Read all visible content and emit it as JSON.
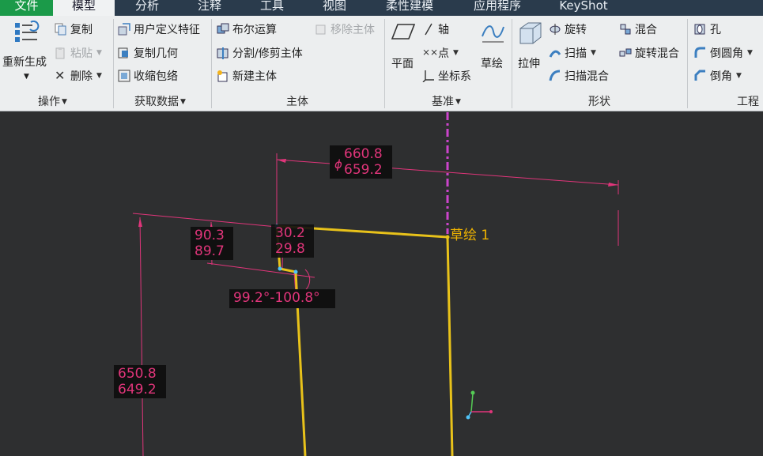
{
  "tabs": [
    {
      "label": "文件"
    },
    {
      "label": "模型"
    },
    {
      "label": "分析"
    },
    {
      "label": "注释"
    },
    {
      "label": "工具"
    },
    {
      "label": "视图"
    },
    {
      "label": "柔性建模"
    },
    {
      "label": "应用程序"
    },
    {
      "label": "KeyShot"
    }
  ],
  "ribbon": {
    "operations": {
      "regenerate": "重新生成",
      "copy": "复制",
      "paste": "粘贴",
      "delete": "删除",
      "group_label": "操作"
    },
    "get_data": {
      "udf": "用户定义特征",
      "copy_geometry": "复制几何",
      "shrinkwrap": "收缩包络",
      "group_label": "获取数据"
    },
    "body": {
      "boolean": "布尔运算",
      "split_trim": "分割/修剪主体",
      "new_body": "新建主体",
      "remove_body": "移除主体",
      "group_label": "主体"
    },
    "datum": {
      "plane": "平面",
      "axis": "轴",
      "point": "点",
      "coord_sys": "坐标系",
      "sketch": "草绘",
      "group_label": "基准"
    },
    "shapes": {
      "extrude": "拉伸",
      "revolve": "旋转",
      "sweep": "扫描",
      "swept_blend": "扫描混合",
      "blend": "混合",
      "rotational_blend": "旋转混合",
      "group_label": "形状"
    },
    "engineering": {
      "hole": "孔",
      "round": "倒圆角",
      "chamfer": "倒角",
      "group_label": "工程"
    }
  },
  "sketch": {
    "label": "草绘 1",
    "dims": {
      "diameter_symbol": "ϕ",
      "diameter_upper": "660.8",
      "diameter_lower": "659.2",
      "left_upper": "90.3",
      "left_lower": "89.7",
      "mid_upper": "30.2",
      "mid_lower": "29.8",
      "angle": "99.2°-100.8°",
      "height_upper": "650.8",
      "height_lower": "649.2"
    }
  },
  "colors": {
    "tab_bar": "#2a3b4c",
    "file_tab": "#1b9a49",
    "ribbon_bg": "#eceeef",
    "canvas_bg": "#2e2f30",
    "dimension": "#e0357a",
    "sketch_line": "#e8c21a",
    "centerline": "#cc44cc"
  }
}
